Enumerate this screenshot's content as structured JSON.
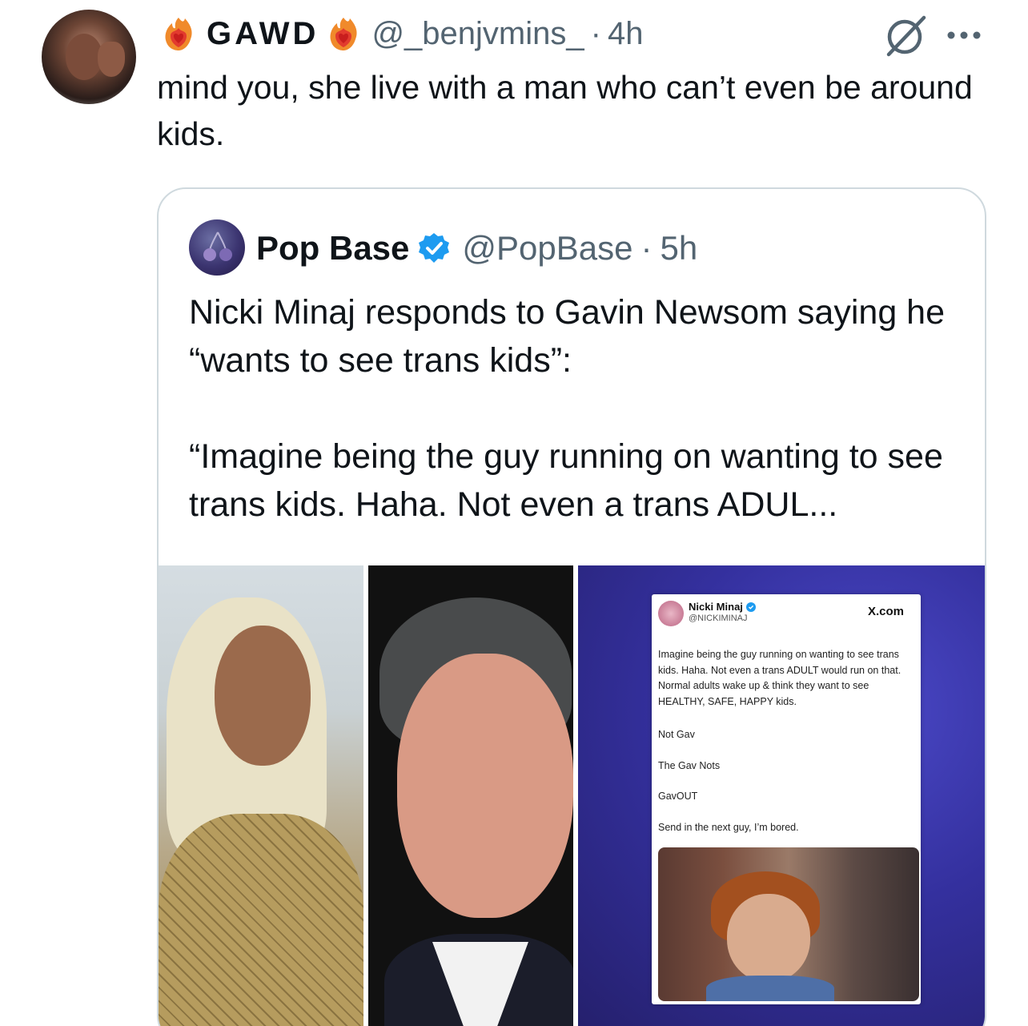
{
  "tweet": {
    "display_name": "GAWD",
    "handle": "@_benjvmins_",
    "separator": "·",
    "time": "4h",
    "text": "mind you, she live with a man who can’t even be around kids."
  },
  "quote": {
    "display_name": "Pop Base",
    "handle": "@PopBase",
    "separator": "·",
    "time": "5h",
    "text": "Nicki Minaj responds to Gavin Newsom saying he “wants to see trans kids”:\n\n“Imagine being the guy running on wanting to see trans kids. Haha. Not even a trans ADUL..."
  },
  "embedded_post": {
    "name": "Nicki Minaj",
    "handle": "@NICKIMINAJ",
    "brand": "X.com",
    "text": "Imagine being the guy running on wanting to see trans kids. Haha. Not even a trans ADULT would run on that. Normal adults wake up & think they want to see HEALTHY, SAFE, HAPPY kids.",
    "line1": "Not Gav",
    "line2": "The Gav Nots",
    "line3": "GavOUT",
    "line4": "Send in the next guy, I’m bored."
  },
  "icons": {
    "flame": "flame-heart-emoji",
    "grok": "grok-icon",
    "more": "more-options-icon",
    "verified": "verified-badge-icon"
  },
  "colors": {
    "verified_blue": "#1d9bf0",
    "secondary_text": "#536471",
    "border": "#cfd9de"
  }
}
